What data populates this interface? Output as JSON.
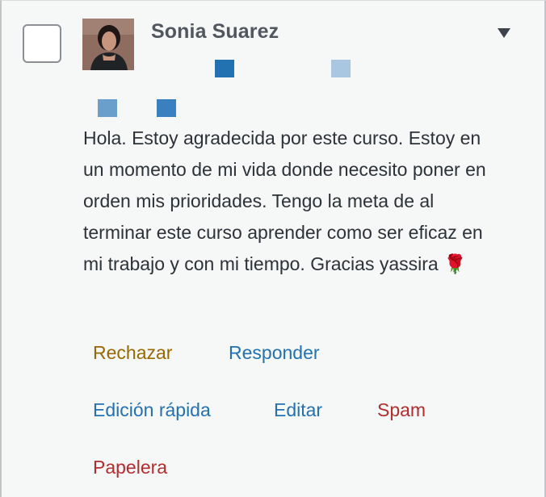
{
  "comment": {
    "author": "Sonia Suarez",
    "text": "Hola. Estoy agradecida por este curso. Estoy en un momento de mi vida donde necesito poner en orden mis prioridades. Tengo la meta de al terminar este curso aprender como ser eficaz en mi trabajo y con mi tiempo. Gracias yassira",
    "emoji": "🌹",
    "avatar_icon": "user-avatar-photo",
    "toggle_icon": "triangle-down-icon"
  },
  "actions": {
    "reject": "Rechazar",
    "reply": "Responder",
    "quick_edit": "Edición rápida",
    "edit": "Editar",
    "spam": "Spam",
    "trash": "Papelera"
  },
  "colors": {
    "reject": "#996800",
    "link": "#2271b1",
    "danger": "#b32d2e",
    "square_dark": "#2271b1",
    "square_light": "#a9c7e0",
    "square_mid": "#6a9fcc",
    "square_mid_dark": "#3a7fbf"
  }
}
